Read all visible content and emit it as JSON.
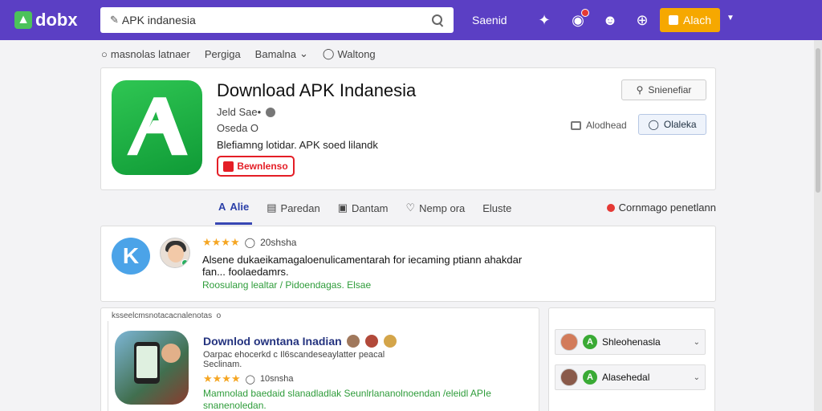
{
  "topbar": {
    "logo_text": "dobx",
    "search_value": "APK indanesia",
    "link": "Saenid",
    "action_button": "Alach"
  },
  "subnav": {
    "items": [
      "masnolas latnaer",
      "Pergiga",
      "Bamalna",
      "Waltong"
    ]
  },
  "app": {
    "title": "Download APK Indanesia",
    "meta1": "Jeld Sae•",
    "meta2": "Oseda O",
    "description": "Blefiamng lotidar. APK soed lilandk",
    "download_label": "Bewnlenso",
    "top_button": "Snienefiar",
    "right_meta": "Alodhead",
    "blue_button": "Olaleka"
  },
  "tabs": {
    "items": [
      "Alie",
      "Paredan",
      "Dantam",
      "Nemp ora",
      "Eluste"
    ],
    "right_label": "Cornmago penetlann"
  },
  "review": {
    "logo_letter": "K",
    "rating_text": "20shsha",
    "text": "Alsene dukaeikamagaloenulicamentarah for iecaming ptiann ahakdar fan... foolaedamrs.",
    "links": "Roosulang lealtar / Pidoendagas. Elsae"
  },
  "article": {
    "header": "ksseelcmsnotacacnalenotas  o",
    "title": "Downlod owntana Inadian",
    "subtitle": "Oarpac ehocerkd c Il6scandeseaylatter peacal Seclinam.",
    "rating_text": "10snsha",
    "description": "Mamnolad baedaid slanadladlak Seunlrlananolnoendan /eleidl APIe snanenoledan."
  },
  "side": {
    "items": [
      "Shleohenasla",
      "Alasehedal"
    ]
  },
  "colors": {
    "topbar": "#5b3fc4",
    "accent_orange": "#f6a800",
    "download_red": "#e41e26",
    "link_green": "#2e9c3a",
    "title_blue": "#24337f"
  }
}
